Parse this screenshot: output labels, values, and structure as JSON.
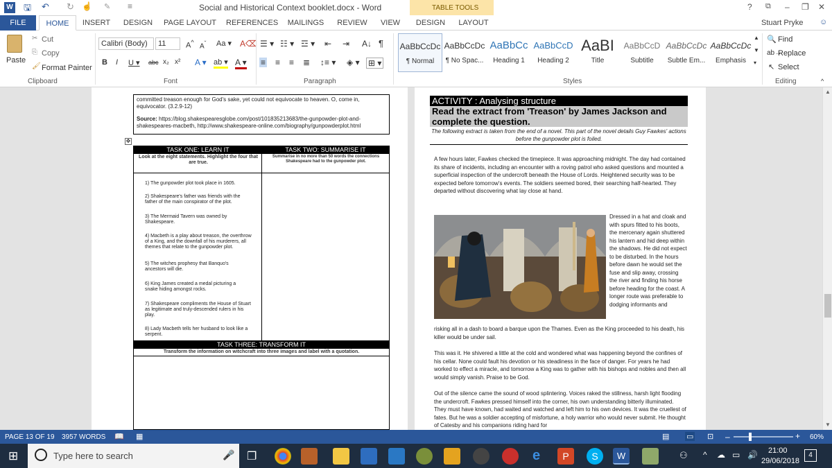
{
  "window": {
    "title": "Social and Historical Context booklet.docx - Word",
    "context_tab": "TABLE TOOLS",
    "user": "Stuart Pryke",
    "help": "?",
    "controls": [
      "–",
      "❐",
      "✕"
    ]
  },
  "tabs": [
    "FILE",
    "HOME",
    "INSERT",
    "DESIGN",
    "PAGE LAYOUT",
    "REFERENCES",
    "MAILINGS",
    "REVIEW",
    "VIEW",
    "DESIGN",
    "LAYOUT"
  ],
  "ribbon": {
    "clipboard": {
      "paste": "Paste",
      "cut": "Cut",
      "copy": "Copy",
      "format_painter": "Format Painter",
      "label": "Clipboard"
    },
    "font": {
      "family": "Calibri (Body)",
      "size": "11",
      "label": "Font"
    },
    "paragraph": {
      "label": "Paragraph"
    },
    "styles": {
      "label": "Styles",
      "items": [
        {
          "sample": "AaBbCcDc",
          "name": "¶ Normal"
        },
        {
          "sample": "AaBbCcDc",
          "name": "¶ No Spac..."
        },
        {
          "sample": "AaBbCc",
          "name": "Heading 1"
        },
        {
          "sample": "AaBbCcD",
          "name": "Heading 2"
        },
        {
          "sample": "AaBI",
          "name": "Title"
        },
        {
          "sample": "AaBbCcD",
          "name": "Subtitle"
        },
        {
          "sample": "AaBbCcDc",
          "name": "Subtle Em..."
        },
        {
          "sample": "AaBbCcDc",
          "name": "Emphasis"
        }
      ]
    },
    "editing": {
      "find": "Find",
      "replace": "Replace",
      "select": "Select",
      "label": "Editing"
    }
  },
  "left_page": {
    "quote_text": "committed treason enough for God's sake, yet could not equivocate to heaven. O, come in, equivocator. (3.2.9-12)",
    "source_label": "Source:",
    "source_text": "https://blog.shakespearesglobe.com/post/101835213683/the-gunpowder-plot-and-shakespeares-macbeth, http://www.shakespeare-online.com/biography/gunpowderplot.html",
    "task1_title": "TASK ONE: LEARN IT",
    "task1_instr": "Look at the eight statements. Highlight the four that are true.",
    "task2_title": "TASK TWO: SUMMARISE IT",
    "task2_instr": "Summarise in no more than 50 words the connections Shakespeare had to the gunpowder plot.",
    "statements": [
      "1)   The gunpowder plot took place in 1605.",
      "2)   Shakespeare's father was friends with the father of the main conspirator of the plot.",
      "3)   The Mermaid Tavern was owned by Shakespeare.",
      "4)   Macbeth is a play about treason, the overthrow of a King, and the downfall of his murderers, all themes that relate to the gunpowder plot.",
      "5)   The witches prophesy that Banquo's ancestors will die.",
      "6)   King James created a medal picturing a snake hiding amongst rocks.",
      "7)   Shakespeare compliments the House of Stuart as legitimate and truly-descended rulers in his play.",
      "8)   Lady Macbeth tells her husband to look like a serpent."
    ],
    "task3_title": "TASK THREE: TRANSFORM IT",
    "task3_instr": "Transform the information on witchcraft into three images and label with a quotation."
  },
  "right_page": {
    "activity_title": "ACTIVITY : Analysing structure",
    "heading": "Read the extract from 'Treason' by James Jackson and complete the question.",
    "intro": "The following extract is taken from the end of a novel. This part of the novel details Guy Fawkes' actions before the gunpowder plot is foiled.",
    "para1": "A few hours later, Fawkes checked the timepiece. It was approaching midnight. The day had contained its share of incidents, including an encounter with a roving patrol who asked questions and mounted a superficial inspection of the undercroft beneath the House of Lords. Heightened security was to be expected before tomorrow's events. The soldiers seemed bored, their searching half-hearted. They departed without discovering what lay close at hand.",
    "para2_side": "Dressed in a hat and cloak and with spurs fitted to his boots, the mercenary again shuttered his lantern and hid deep within the shadows. He did not expect to be disturbed. In the hours before dawn he would set the fuse and slip away, crossing the river and finding his horse before heading for the coast. A longer route was preferable to dodging informants and",
    "para2_rest": "risking all in a dash to board a barque upon the Thames. Even as the King proceeded to his death, his killer would be under sail.",
    "para3": "This was it. He shivered a little at the cold and wondered what was happening beyond the confines of his cellar. None could fault his devotion or his steadiness in the face of danger. For years he had worked to effect a miracle, and tomorrow a King was to gather with his bishops and nobles and then all would simply vanish. Praise to be God.",
    "para4": "Out of the silence came the sound of wood splintering. Voices raked the stillness, harsh light flooding the undercroft. Fawkes pressed himself into the corner, his own understanding bitterly illuminated. They must have known, had waited and watched and left him to his own devices. It was the cruellest of fates. But he was a soldier accepting of misfortune, a holy warrior who would never submit. He thought of Catesby and his companions riding hard for"
  },
  "status": {
    "page": "PAGE 13 OF 19",
    "words": "3957 WORDS",
    "zoom": "60%",
    "zoom_level": 0.6
  },
  "taskbar": {
    "search_placeholder": "Type here to search",
    "time": "21:00",
    "date": "29/06/2018",
    "notifications": "4"
  },
  "colors": {
    "word_blue": "#2b579a",
    "taskbar": "#1e2d40",
    "table_tools": "#fce4a8"
  }
}
